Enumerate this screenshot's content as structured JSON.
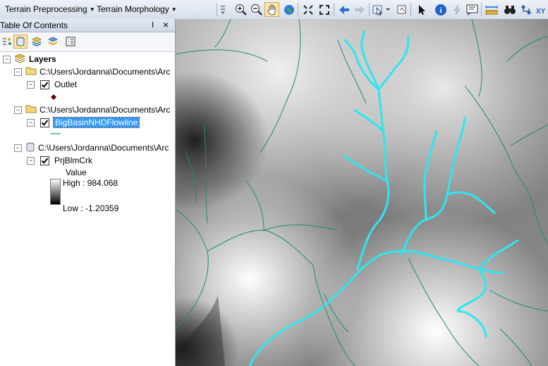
{
  "toolbar": {
    "menus": [
      {
        "label": "Terrain Preprocessing"
      },
      {
        "label": "Terrain Morphology"
      }
    ],
    "icons": [
      "zoom-in-icon",
      "zoom-out-icon",
      "pan-hand-icon",
      "globe-icon",
      "fixed-zoom-in-icon",
      "fixed-zoom-out-icon",
      "back-arrow-icon",
      "forward-arrow-icon",
      "select-features-icon",
      "clear-selection-icon",
      "select-elements-icon",
      "identify-icon",
      "hyperlink-icon",
      "html-popup-icon",
      "measure-icon",
      "find-icon",
      "go-to-xy-icon"
    ]
  },
  "toc": {
    "title": "Table Of Contents",
    "pin_glyph": "Ⅰ",
    "close_glyph": "×",
    "layers_label": "Layers",
    "groups": [
      {
        "path": "C:\\Users\\Jordanna\\Documents\\Arc",
        "layers": [
          {
            "name": "Outlet",
            "checked": true,
            "symbol": "point"
          }
        ]
      },
      {
        "path": "C:\\Users\\Jordanna\\Documents\\Arc",
        "layers": [
          {
            "name": "BigBasinNHDFlowline",
            "checked": true,
            "selected": true,
            "symbol": "line"
          }
        ]
      },
      {
        "path": "C:\\Users\\Jordanna\\Documents\\Arc",
        "layers": [
          {
            "name": "PrjBlmCrk",
            "checked": true,
            "symbol": "raster"
          }
        ]
      }
    ],
    "legend": {
      "value_label": "Value",
      "high": "High : 984.068",
      "low": "Low : -1.20359"
    }
  },
  "colors": {
    "flowline": "#1a8f6a",
    "stream_highlight": "#2ee6ee",
    "outlet": "#5a0000",
    "selection": "#3399ff"
  }
}
